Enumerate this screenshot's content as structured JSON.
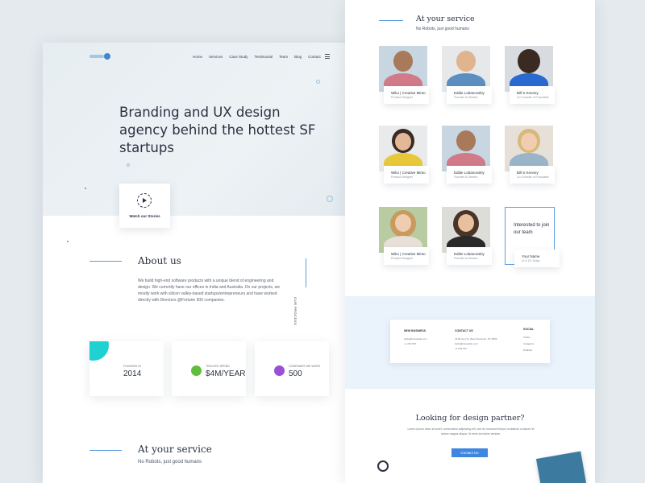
{
  "nav": {
    "items": [
      "Home",
      "Services",
      "Case Study",
      "Testimonial",
      "Team",
      "Blog",
      "Contact"
    ]
  },
  "hero": {
    "headline": "Branding and UX design agency behind the hottest SF startups",
    "video_label": "Watch our Stories"
  },
  "about": {
    "title": "About us",
    "text": "We build high-end software products with a unique blend of engineering and design. We currently have our offices in India and Australia. On our projects, we mostly work with silicon valley-based startups/entrepreneurs and have worked directly with Directors @Fortune 500 companies.",
    "vertical_label": "OUR PROCESS"
  },
  "stats": [
    {
      "label": "FOUNDED IN",
      "value": "2014"
    },
    {
      "label": "TRACKED SPEND",
      "value": "$4M/YEAR"
    },
    {
      "label": "COMPANIES WE WORK",
      "value": "500"
    }
  ],
  "service": {
    "title": "At your service",
    "subtitle": "No Robots, just good humans"
  },
  "team": [
    {
      "name": "Wiko | Creative Minto",
      "role": "Product Designer"
    },
    {
      "name": "Eddie Lobanovskiy",
      "role": "Founder & Director"
    },
    {
      "name": "Bill S Kenney",
      "role": "Co-Founder of Focusable"
    },
    {
      "name": "Wiko | Creative Minto",
      "role": "Product Designer"
    },
    {
      "name": "Eddie Lobanovskiy",
      "role": "Founder & Director"
    },
    {
      "name": "Bill S Kenney",
      "role": "Co-Founder of Focusable"
    },
    {
      "name": "Wiko | Creative Minto",
      "role": "Product Designer"
    },
    {
      "name": "Eddie Lobanovskiy",
      "role": "Founder & Director"
    }
  ],
  "join": {
    "text": "Interested to join our team",
    "name": "Your Name",
    "role": "UI & UX Dsign"
  },
  "contact": {
    "new_business_head": "NEW BUSINESS",
    "new_business": [
      "hello@focusable.com",
      "+1 234 567"
    ],
    "contact_us_head": "CONTACT US",
    "contact_us": [
      "42 Bonnet St, West Seminole, NY 4800",
      "hello@focusable.com",
      "+1 234 567"
    ],
    "social_head": "SOCIAL",
    "social": [
      "Twitter",
      "Instagram",
      "Dribbble"
    ]
  },
  "partner": {
    "title": "Looking for design partner?",
    "text": "Lorem ipsum dolor sit amet, consectetur adipiscing elit, sed do eiusmod tempor incididunt ut labore et dolore magna aliqua. Ut enim ad minim veniam.",
    "button": "Contact Us"
  },
  "colors": {
    "accent": "#3f86e0",
    "teal": "#1fd1d1",
    "green": "#5fbf3c",
    "purple": "#9a4fd4"
  }
}
